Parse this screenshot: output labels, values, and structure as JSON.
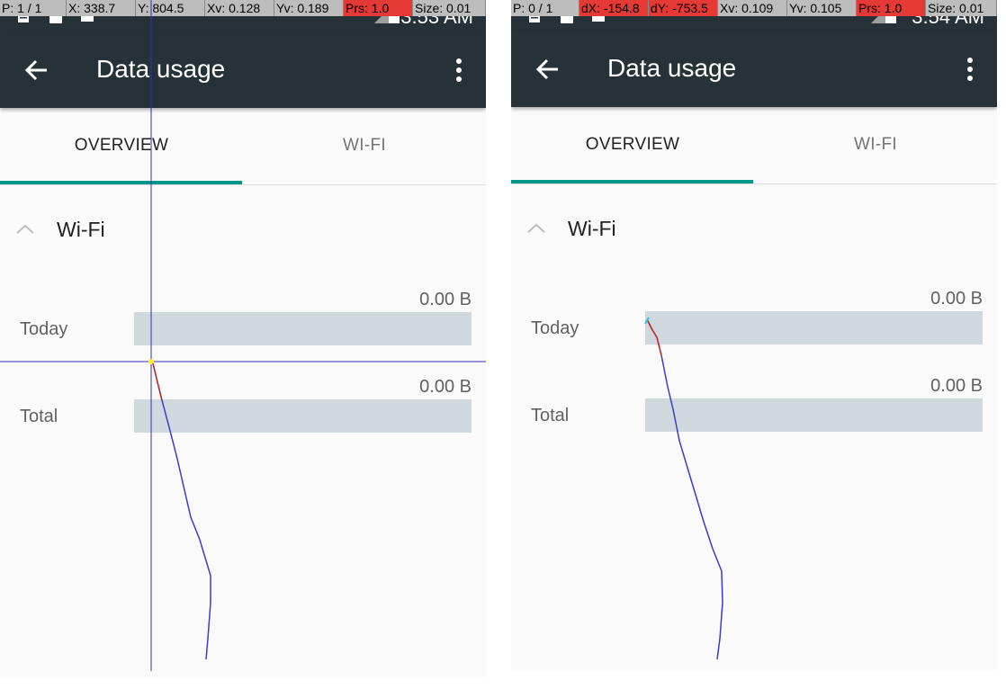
{
  "screens": [
    {
      "overlay": {
        "pointer": "P: 1 / 1",
        "x": "X: 338.7",
        "y": "Y: 804.5",
        "xv": "Xv: 0.128",
        "yv": "Yv: 0.189",
        "prs": "Prs: 1.0",
        "size": "Size: 0.01"
      },
      "status_time": "3:53 AM",
      "title": "Data usage",
      "tabs": [
        "OVERVIEW",
        "WI-FI"
      ],
      "section_title": "Wi-Fi",
      "rows": [
        {
          "label": "Today",
          "value": "0.00 B"
        },
        {
          "label": "Total",
          "value": "0.00 B"
        }
      ]
    },
    {
      "overlay": {
        "pointer": "P: 0 / 1",
        "dx": "dX: -154.8",
        "dy": "dY: -753.5",
        "xv": "Xv: 0.109",
        "yv": "Yv: 0.105",
        "prs": "Prs: 1.0",
        "size": "Size: 0.01"
      },
      "status_time": "3:54 AM",
      "title": "Data usage",
      "tabs": [
        "OVERVIEW",
        "WI-FI"
      ],
      "section_title": "Wi-Fi",
      "rows": [
        {
          "label": "Today",
          "value": "0.00 B"
        },
        {
          "label": "Total",
          "value": "0.00 B"
        }
      ]
    }
  ],
  "icons": {
    "status_left": [
      "clipboard-icon",
      "lock-icon",
      "android-icon"
    ],
    "status_right": [
      "signal-icon",
      "battery-icon"
    ],
    "toolbar": [
      "back-arrow-icon",
      "more-vert-icon"
    ],
    "section": "chevron-up-icon"
  },
  "colors": {
    "toolbar": "#263238",
    "accent": "#009688",
    "bar": "#cfd8dc",
    "overlay_red": "#e53935",
    "overlay_grey": "#bdbdbd"
  }
}
